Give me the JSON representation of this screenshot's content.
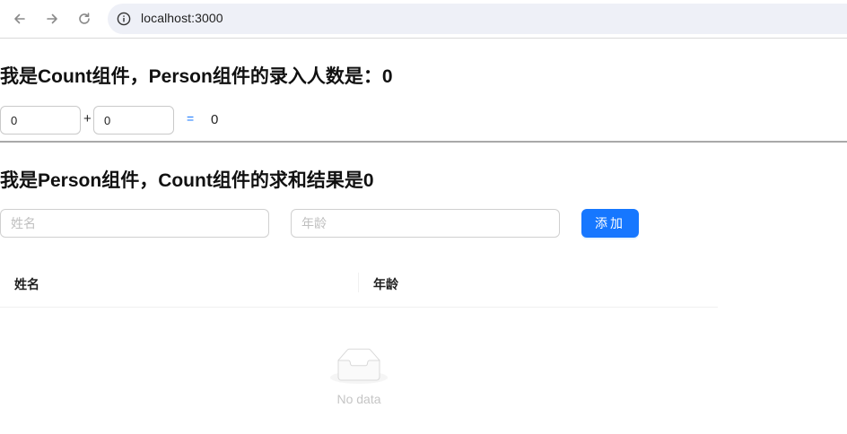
{
  "browser": {
    "url": "localhost:3000"
  },
  "count": {
    "title": "我是Count组件，Person组件的录入人数是：0",
    "input_a": "0",
    "plus": "+",
    "input_b": "0",
    "equals": "=",
    "result": "0"
  },
  "person": {
    "title": "我是Person组件，Count组件的求和结果是0",
    "name_placeholder": "姓名",
    "age_placeholder": "年龄",
    "add_label": "添加",
    "table": {
      "columns": [
        "姓名",
        "年龄"
      ],
      "rows": [],
      "empty_text": "No data"
    }
  },
  "colors": {
    "primary": "#1677ff",
    "divider": "#a9a9a9"
  },
  "icons": [
    "back-arrow-icon",
    "forward-arrow-icon",
    "reload-icon",
    "site-info-icon",
    "empty-inbox-icon"
  ]
}
